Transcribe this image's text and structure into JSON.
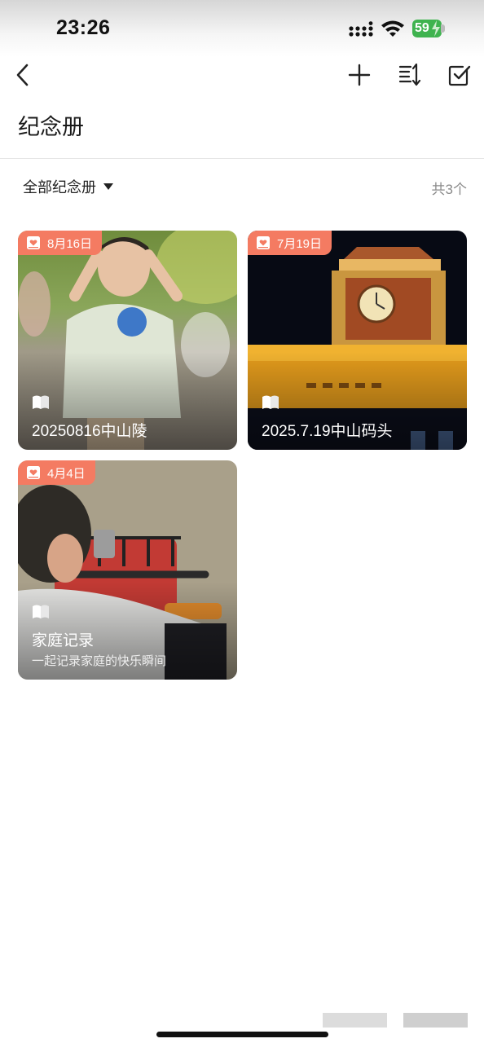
{
  "status_bar": {
    "time": "23:26",
    "battery": "59"
  },
  "nav": {
    "back_icon": "chevron-left-icon",
    "add_icon": "plus-icon",
    "sort_icon": "sort-icon",
    "select_icon": "checkbox-icon"
  },
  "page": {
    "title": "纪念册"
  },
  "filter": {
    "label": "全部纪念册",
    "count": "共3个"
  },
  "albums": [
    {
      "date": "8月16日",
      "title": "20250816中山陵",
      "subtitle": ""
    },
    {
      "date": "7月19日",
      "title": "2025.7.19中山码头",
      "subtitle": ""
    },
    {
      "date": "4月4日",
      "title": "家庭记录",
      "subtitle": "一起记录家庭的快乐瞬间"
    }
  ],
  "colors": {
    "badge": "#f47b62",
    "battery": "#3fb34f"
  }
}
